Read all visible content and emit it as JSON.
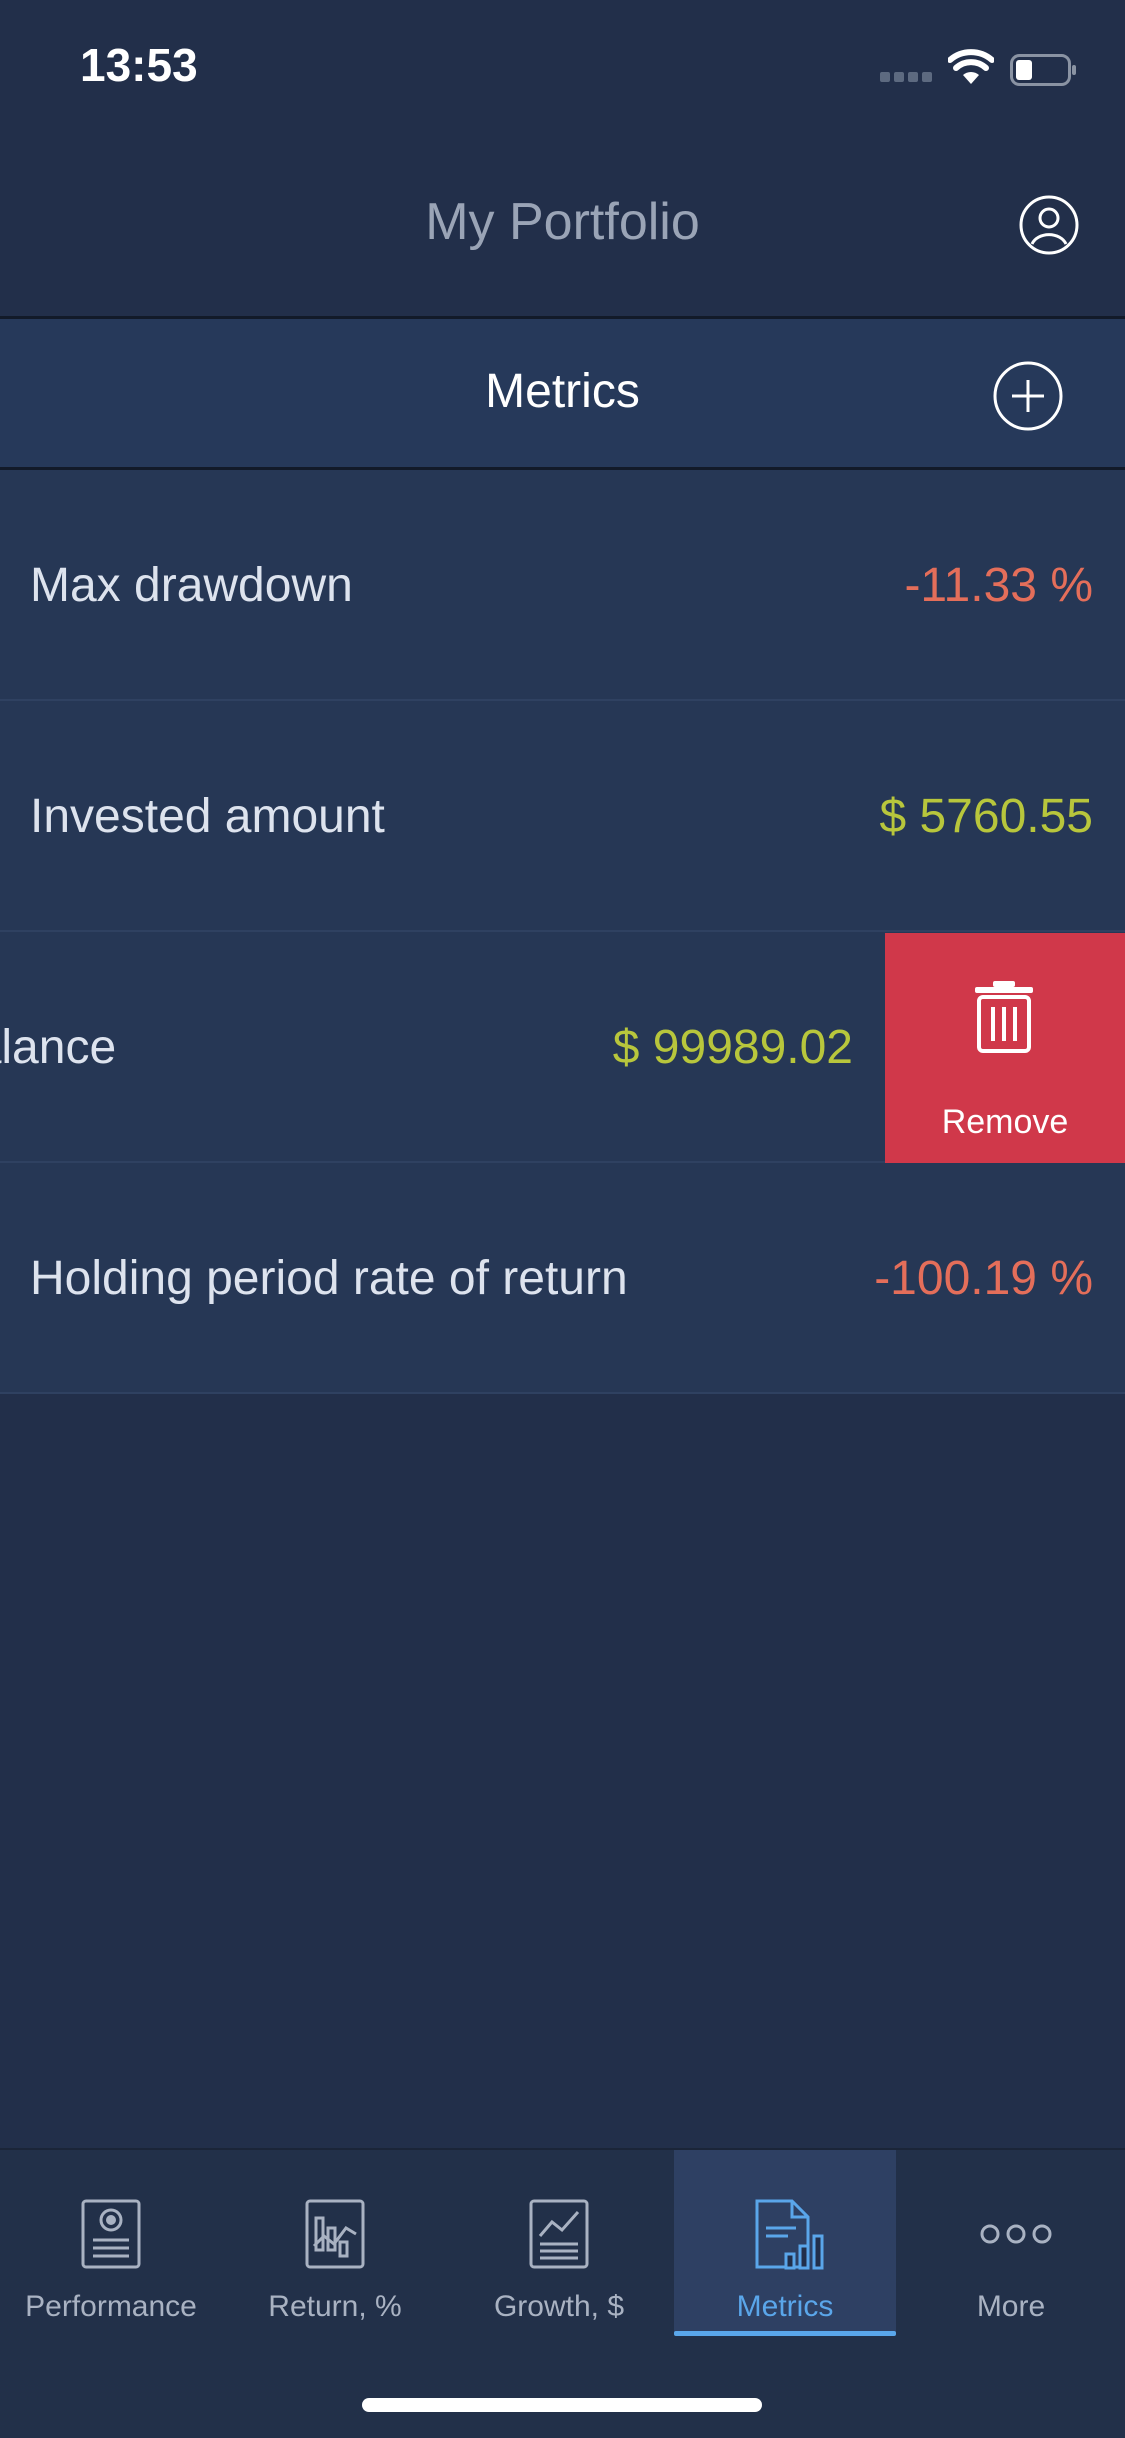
{
  "status_bar": {
    "time": "13:53"
  },
  "header": {
    "title": "My Portfolio"
  },
  "section": {
    "title": "Metrics"
  },
  "metrics": [
    {
      "label": "Max drawdown",
      "value": "-11.33 %"
    },
    {
      "label": "Invested amount",
      "value": "$ 5760.55"
    },
    {
      "label": "balance",
      "value": "$ 99989.02"
    },
    {
      "label": "Holding period rate of return",
      "value": "-100.19 %"
    }
  ],
  "swipe_action": {
    "label": "Remove",
    "icon": "trash-icon"
  },
  "tabs": [
    {
      "label": "Performance",
      "icon": "performance-icon"
    },
    {
      "label": "Return, %",
      "icon": "return-chart-icon"
    },
    {
      "label": "Growth, $",
      "icon": "growth-chart-icon"
    },
    {
      "label": "Metrics",
      "icon": "metrics-icon",
      "active": true
    },
    {
      "label": "More",
      "icon": "more-dots-icon"
    }
  ],
  "colors": {
    "background": "#222f4a",
    "row": "#263755",
    "negative": "#e46e5a",
    "positive": "#b8c63c",
    "remove": "#d0384a",
    "active_tab": "#5aa6ea"
  }
}
